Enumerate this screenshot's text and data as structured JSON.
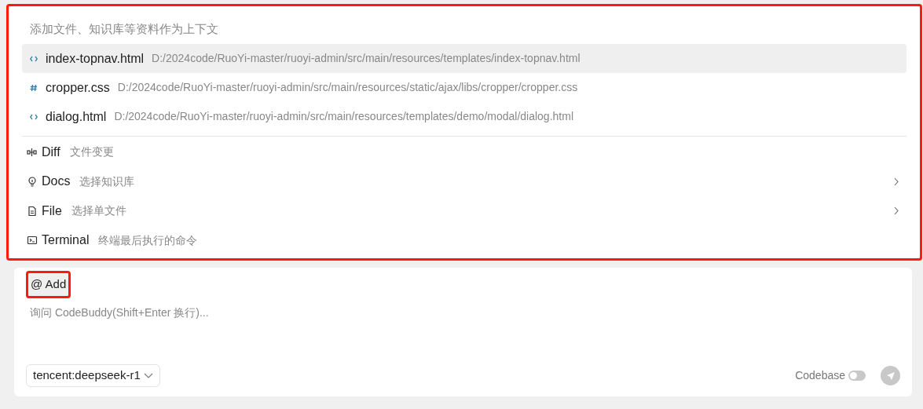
{
  "context_popup": {
    "highlighted": true,
    "search": {
      "placeholder": "添加文件、知识库等资料作为上下文"
    },
    "files": [
      {
        "kind": "html",
        "name": "index-topnav.html",
        "path": "D:/2024code/RuoYi-master/ruoyi-admin/src/main/resources/templates/index-topnav.html",
        "selected": true
      },
      {
        "kind": "css",
        "name": "cropper.css",
        "path": "D:/2024code/RuoYi-master/ruoyi-admin/src/main/resources/static/ajax/libs/cropper/cropper.css",
        "selected": false
      },
      {
        "kind": "html",
        "name": "dialog.html",
        "path": "D:/2024code/RuoYi-master/ruoyi-admin/src/main/resources/templates/demo/modal/dialog.html",
        "selected": false
      }
    ],
    "menu": [
      {
        "kind": "diff",
        "label": "Diff",
        "hint": "文件变更",
        "has_submenu": false
      },
      {
        "kind": "docs",
        "label": "Docs",
        "hint": "选择知识库",
        "has_submenu": true
      },
      {
        "kind": "file",
        "label": "File",
        "hint": "选择单文件",
        "has_submenu": true
      },
      {
        "kind": "terminal",
        "label": "Terminal",
        "hint": "终端最后执行的命令",
        "has_submenu": false
      }
    ]
  },
  "chat_input": {
    "add_button": {
      "label": "@ Add",
      "highlighted": true
    },
    "placeholder": "询问 CodeBuddy(Shift+Enter 换行)...",
    "model": "tencent:deepseek-r1",
    "codebase": {
      "label": "Codebase",
      "on": false
    }
  }
}
